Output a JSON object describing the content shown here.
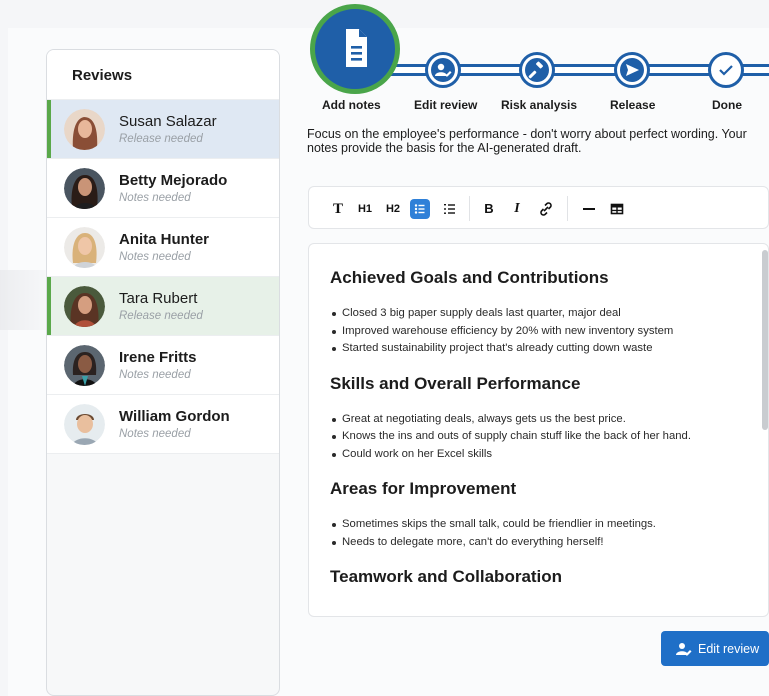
{
  "sidebar": {
    "title": "Reviews",
    "items": [
      {
        "name": "Susan Salazar",
        "status": "Release needed",
        "state": "selected-blue",
        "bold": false,
        "avatar_color": "#9b5a40"
      },
      {
        "name": "Betty Mejorado",
        "status": "Notes needed",
        "state": "normal",
        "bold": true,
        "avatar_color": "#3a2a24"
      },
      {
        "name": "Anita Hunter",
        "status": "Notes needed",
        "state": "normal",
        "bold": true,
        "avatar_color": "#d9b68a"
      },
      {
        "name": "Tara Rubert",
        "status": "Release needed",
        "state": "selected-green",
        "bold": false,
        "avatar_color": "#5b3b2e"
      },
      {
        "name": "Irene Fritts",
        "status": "Notes needed",
        "state": "normal",
        "bold": true,
        "avatar_color": "#3c3836"
      },
      {
        "name": "William Gordon",
        "status": "Notes needed",
        "state": "normal",
        "bold": true,
        "avatar_color": "#b9a48c"
      }
    ]
  },
  "stepper": {
    "steps": [
      {
        "label": "Add notes",
        "icon": "document-icon",
        "state": "active"
      },
      {
        "label": "Edit review",
        "icon": "user-edit-icon",
        "state": "pending"
      },
      {
        "label": "Risk analysis",
        "icon": "gavel-icon",
        "state": "pending"
      },
      {
        "label": "Release",
        "icon": "send-icon",
        "state": "pending"
      },
      {
        "label": "Done",
        "icon": "check-icon",
        "state": "pending"
      }
    ]
  },
  "intro_text": "Focus on the employee's performance - don't worry about perfect wording. Your notes provide the basis for the AI-generated draft.",
  "toolbar": {
    "text": "T",
    "h1": "H1",
    "h2": "H2",
    "bold": "B",
    "italic": "I",
    "active_tool": "bullet-list"
  },
  "editor": {
    "sections": [
      {
        "heading": "Achieved Goals and Contributions",
        "items": [
          "Closed 3 big paper supply deals last quarter, major deal",
          "Improved warehouse efficiency by 20% with new inventory system",
          "Started sustainability project that's already cutting down waste"
        ]
      },
      {
        "heading": "Skills and Overall Performance",
        "items": [
          "Great at negotiating deals, always gets us the best price.",
          "Knows the ins and outs of supply chain stuff like the back of her hand.",
          "Could work on her Excel skills"
        ]
      },
      {
        "heading": "Areas for Improvement",
        "items": [
          "Sometimes skips the small talk, could be friendlier in meetings.",
          "Needs to delegate more, can't do everything herself!"
        ]
      },
      {
        "heading": "Teamwork and Collaboration",
        "items": []
      }
    ]
  },
  "edit_button": {
    "label": "Edit review",
    "icon": "user-edit-icon"
  },
  "colors": {
    "primary": "#1f5fa8",
    "accent_green": "#4aa54a",
    "button": "#1f6fc7"
  }
}
